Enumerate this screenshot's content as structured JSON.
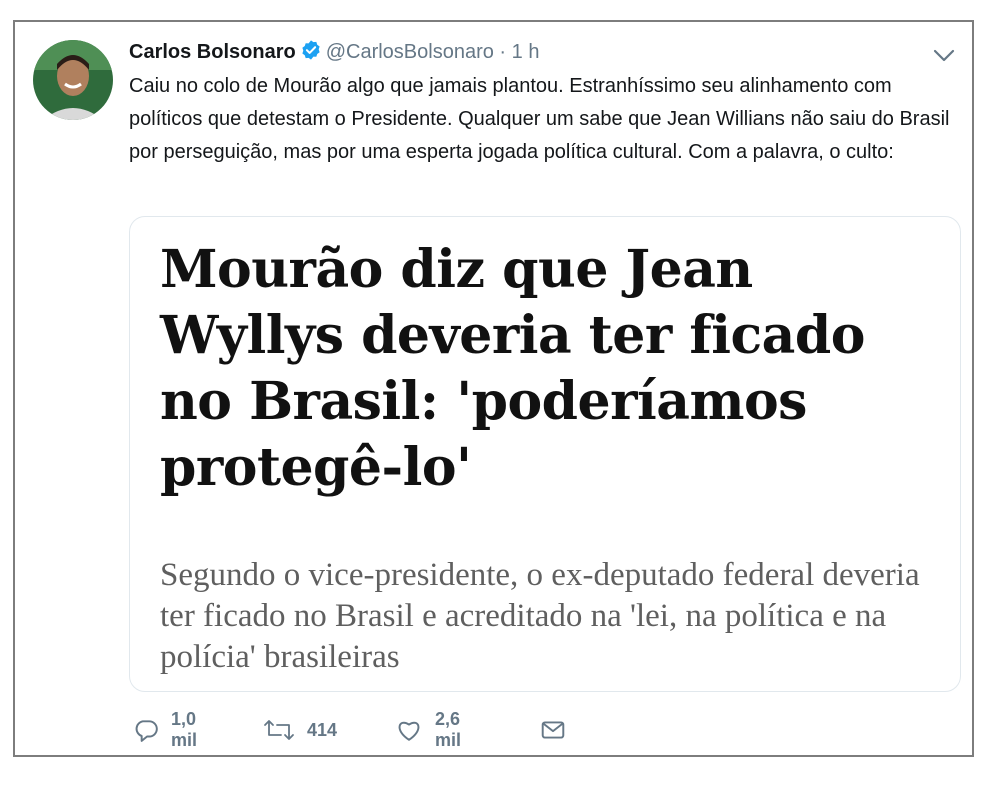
{
  "tweet": {
    "author_name": "Carlos Bolsonaro",
    "handle": "@CarlosBolsonaro",
    "separator": "·",
    "time": "1 h",
    "text": "Caiu no colo de Mourão algo que jamais plantou. Estranhíssimo seu alinhamento com políticos que detestam o Presidente. Qualquer um sabe que Jean Willians não saiu do Brasil por perseguição, mas por uma esperta jogada política cultural. Com a palavra, o culto:",
    "card": {
      "title": "Mourão diz que Jean Wyllys deveria ter ficado no Brasil: 'poderíamos protegê-lo'",
      "subtitle": "Segundo o vice-presidente, o ex-deputado federal deveria ter ficado no Brasil e acreditado na 'lei, na política e na polícia' brasileiras"
    },
    "actions": {
      "replies": "1,0 mil",
      "retweets": "414",
      "likes": "2,6 mil"
    }
  },
  "colors": {
    "verified_blue": "#1da1f2",
    "muted_gray": "#657786",
    "border": "#e1e8ed"
  },
  "icons": [
    "verified-badge-icon",
    "chevron-down-icon",
    "reply-icon",
    "retweet-icon",
    "like-icon",
    "direct-message-icon"
  ]
}
